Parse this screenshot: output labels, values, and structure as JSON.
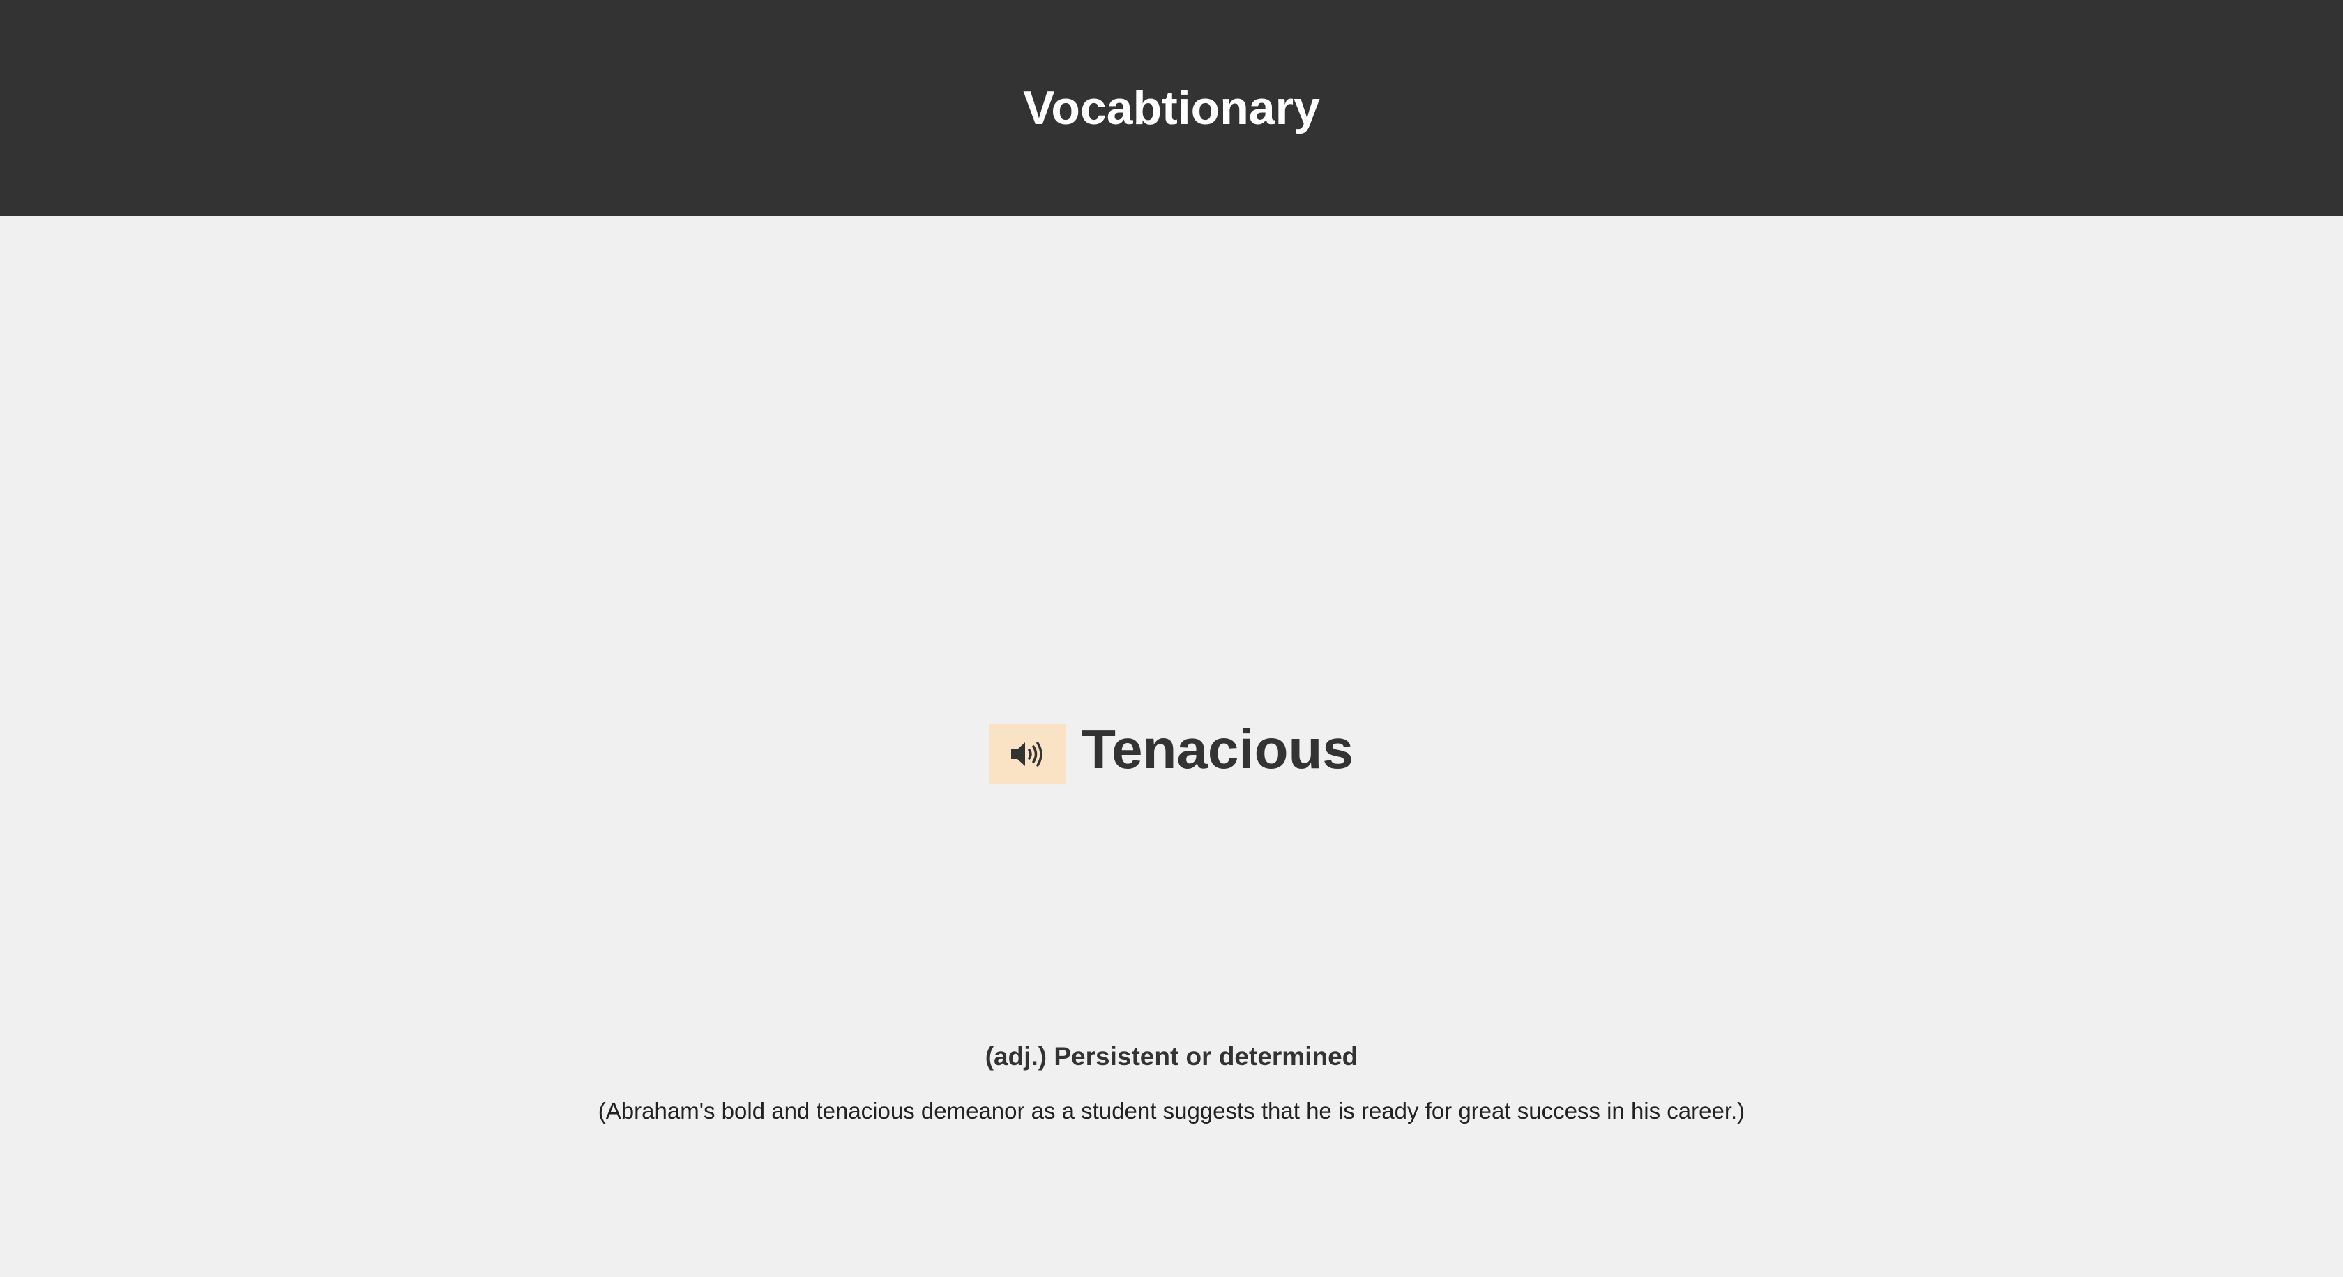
{
  "header": {
    "title": "Vocabtionary"
  },
  "word": {
    "term": "Tenacious",
    "speak_icon": "speaker-volume-icon",
    "definition": "(adj.) Persistent or determined",
    "example": "(Abraham's bold and tenacious demeanor as a student suggests that he is ready for great success in his career.)"
  },
  "colors": {
    "header_background": "#333333",
    "page_background": "#f0f0f0",
    "speak_button_background": "#fae3c5",
    "text": "#333333"
  }
}
